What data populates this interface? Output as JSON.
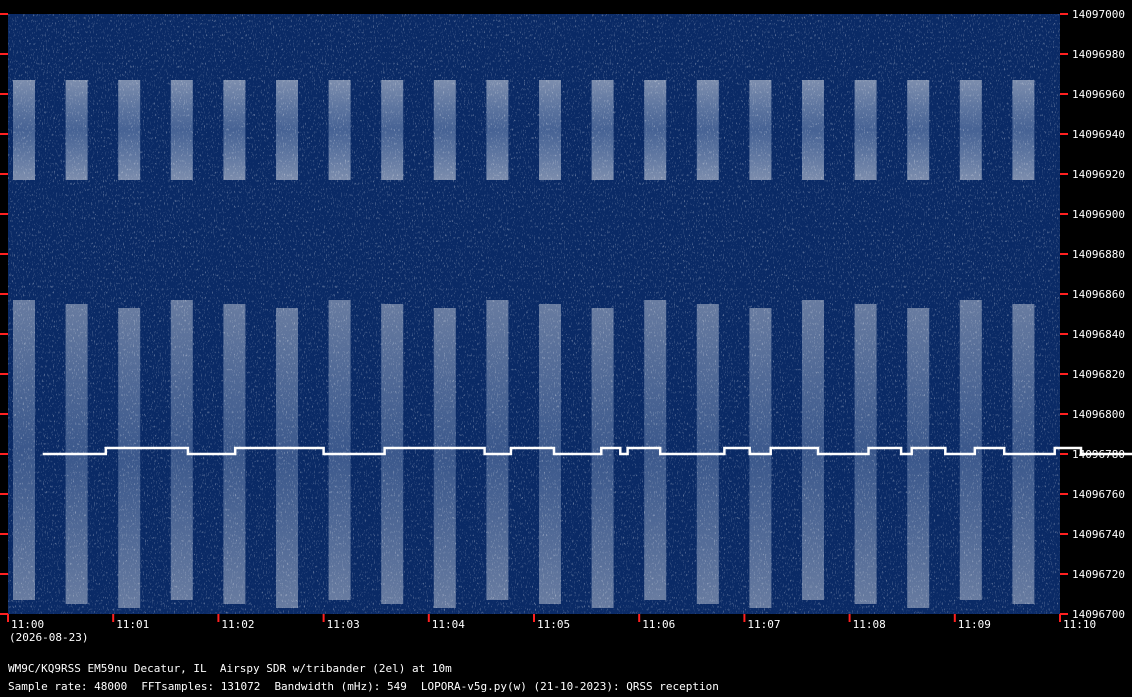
{
  "chart_data": {
    "type": "heatmap",
    "title": "",
    "xlabel": "",
    "ylabel": "",
    "x_ticks": [
      "11:00",
      "11:01",
      "11:02",
      "11:03",
      "11:04",
      "11:05",
      "11:06",
      "11:07",
      "11:08",
      "11:09",
      "11:10"
    ],
    "x_date": "(2026-08-23)",
    "ylim": [
      14096700,
      14097000
    ],
    "y_ticks": [
      14096700,
      14096720,
      14096740,
      14096760,
      14096780,
      14096800,
      14096820,
      14096840,
      14096860,
      14096880,
      14096900,
      14096920,
      14096940,
      14096960,
      14096980,
      14097000
    ],
    "background_color": "#0a2a66",
    "signal_color": "#ffffff",
    "tick_color": "#ff2020",
    "traces": [
      {
        "name": "",
        "points": [
          [
            11.033,
            14096780
          ],
          [
            11.093,
            14096780
          ],
          [
            11.093,
            14096783
          ],
          [
            11.171,
            14096783
          ],
          [
            11.171,
            14096780
          ],
          [
            11.216,
            14096780
          ],
          [
            11.216,
            14096783
          ],
          [
            11.3,
            14096783
          ],
          [
            11.3,
            14096780
          ],
          [
            11.358,
            14096780
          ],
          [
            11.358,
            14096783
          ],
          [
            11.453,
            14096783
          ],
          [
            11.453,
            14096780
          ],
          [
            11.478,
            14096780
          ],
          [
            11.478,
            14096783
          ],
          [
            11.519,
            14096783
          ],
          [
            11.519,
            14096780
          ],
          [
            11.564,
            14096780
          ],
          [
            11.564,
            14096783
          ],
          [
            11.582,
            14096783
          ],
          [
            11.582,
            14096780
          ],
          [
            11.589,
            14096780
          ],
          [
            11.589,
            14096783
          ],
          [
            11.62,
            14096783
          ],
          [
            11.62,
            14096780
          ],
          [
            11.681,
            14096780
          ],
          [
            11.681,
            14096783
          ],
          [
            11.705,
            14096783
          ],
          [
            11.705,
            14096780
          ],
          [
            11.725,
            14096780
          ],
          [
            11.725,
            14096783
          ],
          [
            11.77,
            14096783
          ],
          [
            11.77,
            14096780
          ],
          [
            11.818,
            14096780
          ],
          [
            11.818,
            14096783
          ],
          [
            11.849,
            14096783
          ],
          [
            11.849,
            14096780
          ],
          [
            11.859,
            14096780
          ],
          [
            11.859,
            14096783
          ],
          [
            11.891,
            14096783
          ],
          [
            11.891,
            14096780
          ],
          [
            11.919,
            14096780
          ],
          [
            11.919,
            14096783
          ],
          [
            11.947,
            14096783
          ],
          [
            11.947,
            14096780
          ],
          [
            11.995,
            14096780
          ],
          [
            11.995,
            14096783
          ],
          [
            12.02,
            14096783
          ],
          [
            12.02,
            14096780
          ],
          [
            12.074,
            14096780
          ]
        ]
      }
    ]
  },
  "footer": {
    "station": "WM9C/KQ9RSS EM59nu Decatur, IL  Airspy SDR w/tribander (2el) at 10m",
    "sample_rate": "Sample rate: 48000",
    "fft_samples": "FFTsamples: 131072",
    "bandwidth": "Bandwidth (mHz): 549",
    "software": "LOPORA-v5g.py(w) (21-10-2023): QRSS reception"
  }
}
